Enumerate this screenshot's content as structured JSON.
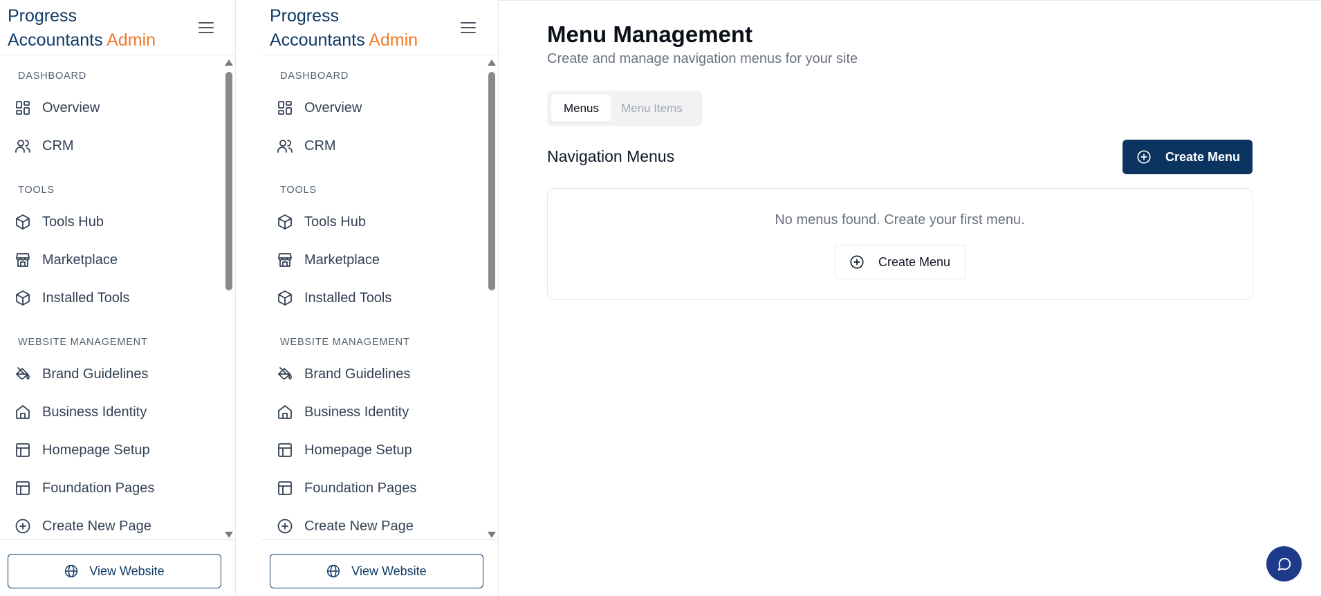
{
  "brand": {
    "name": "Progress",
    "name_line2": "Accountants",
    "suffix": "Admin"
  },
  "colors": {
    "brand": "#0f3a66",
    "accent": "#f07b2c",
    "primary_button": "#0c3461",
    "chat": "#1e3a8a"
  },
  "icons": {
    "menu_toggle": "hamburger-icon",
    "overview": "dashboard-grid-icon",
    "crm": "users-icon",
    "tools_hub": "package-icon",
    "marketplace": "store-icon",
    "installed_tools": "package-icon",
    "brand_guidelines": "paint-bucket-icon",
    "business_identity": "home-icon",
    "homepage_setup": "layout-icon",
    "foundation_pages": "layout-icon",
    "create_new_page": "plus-circle-icon",
    "view_website": "globe-icon",
    "chat": "message-circle-icon"
  },
  "sidebar": {
    "sections": {
      "dashboard": "DASHBOARD",
      "tools": "TOOLS",
      "website": "WEBSITE MANAGEMENT"
    },
    "items": {
      "overview": "Overview",
      "crm": "CRM",
      "tools_hub": "Tools Hub",
      "marketplace": "Marketplace",
      "installed_tools": "Installed Tools",
      "brand_guidelines": "Brand Guidelines",
      "business_identity": "Business Identity",
      "homepage_setup": "Homepage Setup",
      "foundation_pages": "Foundation Pages",
      "create_new_page": "Create New Page"
    },
    "footer": {
      "view_website": "View Website"
    }
  },
  "main": {
    "title": "Menu Management",
    "subtitle": "Create and manage navigation menus for your site",
    "tabs": [
      {
        "label": "Menus",
        "active": true
      },
      {
        "label": "Menu Items",
        "active": false
      }
    ],
    "section_title": "Navigation Menus",
    "create_button": "Create Menu",
    "empty": {
      "message": "No menus found. Create your first menu.",
      "button": "Create Menu"
    }
  }
}
